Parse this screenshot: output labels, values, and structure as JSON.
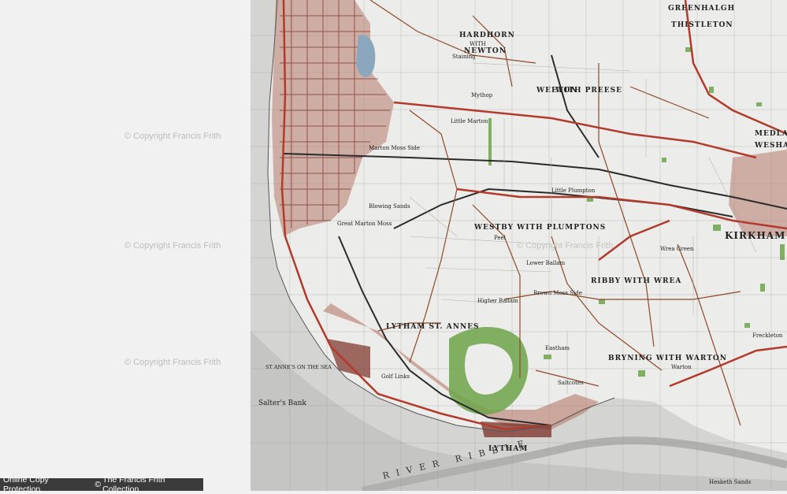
{
  "watermarks": [
    {
      "symbol": "©",
      "text": "Copyright Francis Frith"
    },
    {
      "symbol": "©",
      "text": "Copyright Francis Frith"
    },
    {
      "symbol": "©",
      "text": "Copyright Francis Frith"
    },
    {
      "symbol": "©",
      "text": "Copyright Francis Frith"
    }
  ],
  "footer": {
    "protection": "Online Copy Protection.",
    "symbol": "©",
    "collection": "The Francis Frith Collection"
  },
  "map_labels": {
    "greenhalgh": "GREENHALGH",
    "thistleton": "THISTLETON",
    "hardhorn": "HARDHORN",
    "with": "WITH",
    "newton": "NEWTON",
    "weeton": "WEETON",
    "with_preese": "WITH PREESE",
    "medlar": "MEDLAR",
    "wesham": "WESHAM",
    "little_marton": "Little Marton",
    "little_plumpton": "Little Plumpton",
    "westby_plumptons": "WESTBY WITH PLUMPTONS",
    "kirkham": "KIRKHAM",
    "ribby_wrea": "RIBBY WITH WREA",
    "wrea_green": "Wrea Green",
    "lytham_st_annes": "LYTHAM ST. ANNES",
    "st_annes_on_sea": "ST ANNE'S ON THE SEA",
    "lytham": "LYTHAM",
    "river_ribble": "RIVER RIBBLE",
    "salters_bank": "Salter's Bank",
    "golf_links": "Golf Links",
    "warton": "Warton",
    "freckleton": "Freckleton",
    "bryning": "BRYNING WITH WARTON",
    "peel": "Peel",
    "lower_ballam": "Lower Ballam",
    "higher_ballam": "Higher Ballam",
    "brown_moss_side": "Brown Moss Side",
    "marton_moss_side": "Marton Moss Side",
    "blowing_sands": "Blowing Sands",
    "great_marton_moss": "Great Marton Moss",
    "mythop": "Mythop",
    "staining": "Staining",
    "eastham": "Eastham",
    "saltcotes": "Saltcotes",
    "hesketh_sands": "Hesketh Sands"
  },
  "colors": {
    "paper": "#f1f1f1",
    "sea": "#c9c9c9",
    "urban": "#7a2f24",
    "road_red": "#b23a2a",
    "road_brown": "#8b4a2a",
    "rail": "#2b2b2b",
    "woodland": "#6fa54a",
    "water": "#6a8fb0"
  }
}
